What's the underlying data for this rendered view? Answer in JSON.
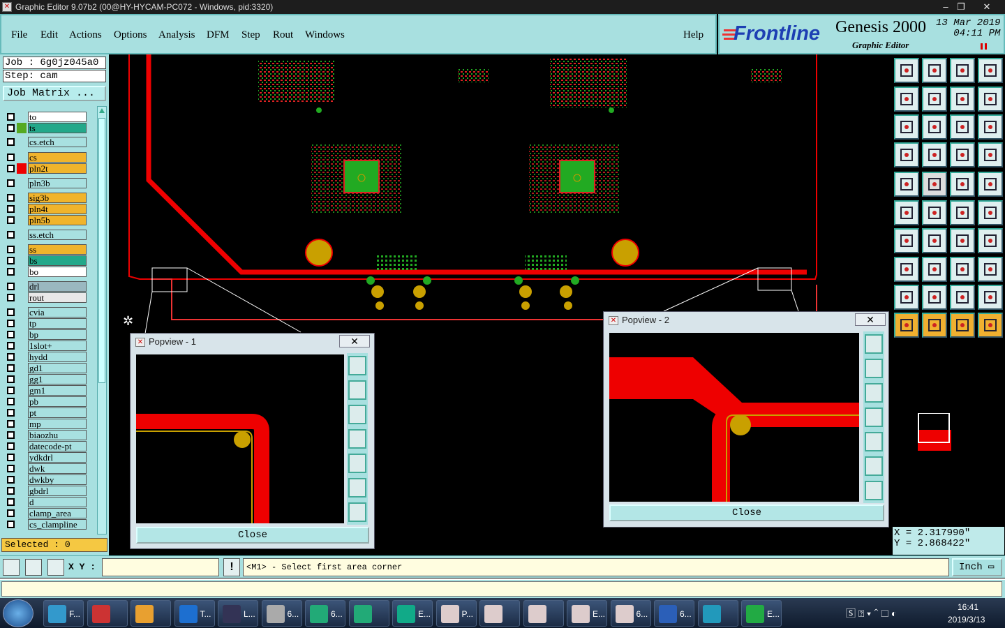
{
  "window": {
    "title": "Graphic Editor 9.07b2 (00@HY-HYCAM-PC072 - Windows, pid:3320)"
  },
  "menu": [
    "File",
    "Edit",
    "Actions",
    "Options",
    "Analysis",
    "DFM",
    "Step",
    "Rout",
    "Windows"
  ],
  "help": "Help",
  "brand": {
    "logo": "Frontline",
    "product": "Genesis 2000",
    "subtitle": "Graphic Editor",
    "date": "13 Mar 2019",
    "time": "04:11 PM"
  },
  "job": {
    "job_label": "Job : 6g0jz045a0",
    "step_label": "Step: cam",
    "matrix_button": "Job Matrix ..."
  },
  "layers": [
    {
      "name": "to",
      "color": "#ffffff"
    },
    {
      "name": "ts",
      "color": "#23a88a"
    },
    {
      "name": "cs.etch",
      "color": "#a8e0e0"
    },
    {
      "name": "cs",
      "color": "#f0b42c"
    },
    {
      "name": "pln2t",
      "color": "#f0b42c"
    },
    {
      "name": "pln3b",
      "color": "#a8e0e0"
    },
    {
      "name": "sig3b",
      "color": "#f0b42c"
    },
    {
      "name": "pln4t",
      "color": "#f0b42c"
    },
    {
      "name": "pln5b",
      "color": "#f0b42c"
    },
    {
      "name": "ss.etch",
      "color": "#a8e0e0"
    },
    {
      "name": "ss",
      "color": "#f0b42c"
    },
    {
      "name": "bs",
      "color": "#23a88a"
    },
    {
      "name": "bo",
      "color": "#ffffff"
    },
    {
      "name": "drl",
      "color": "#9ab8c0"
    },
    {
      "name": "rout",
      "color": "#e8e8e8"
    },
    {
      "name": "cvia",
      "color": "#a8e0e0"
    },
    {
      "name": "tp",
      "color": "#a8e0e0"
    },
    {
      "name": "bp",
      "color": "#a8e0e0"
    },
    {
      "name": "1slot+",
      "color": "#a8e0e0"
    },
    {
      "name": "hydd",
      "color": "#a8e0e0"
    },
    {
      "name": "gd1",
      "color": "#a8e0e0"
    },
    {
      "name": "gg1",
      "color": "#a8e0e0"
    },
    {
      "name": "gm1",
      "color": "#a8e0e0"
    },
    {
      "name": "pb",
      "color": "#a8e0e0"
    },
    {
      "name": "pt",
      "color": "#a8e0e0"
    },
    {
      "name": "mp",
      "color": "#a8e0e0"
    },
    {
      "name": "biaozhu",
      "color": "#a8e0e0"
    },
    {
      "name": "datecode-pt",
      "color": "#a8e0e0"
    },
    {
      "name": "ydkdrl",
      "color": "#a8e0e0"
    },
    {
      "name": "dwk",
      "color": "#a8e0e0"
    },
    {
      "name": "dwkby",
      "color": "#a8e0e0"
    },
    {
      "name": "gbdrl",
      "color": "#a8e0e0"
    },
    {
      "name": "d",
      "color": "#a8e0e0"
    },
    {
      "name": "clamp_area",
      "color": "#a8e0e0"
    },
    {
      "name": "cs_clampline",
      "color": "#a8e0e0"
    }
  ],
  "selected": "Selected : 0",
  "coords": {
    "x": "X = 2.317990\"",
    "y": "Y = 2.868422\""
  },
  "bottom": {
    "xy_label": "X Y :",
    "xy_value": "",
    "prompt": "<M1> - Select first area corner",
    "units": "Inch"
  },
  "popview1": {
    "title": "Popview - 1",
    "close": "Close"
  },
  "popview2": {
    "title": "Popview - 2",
    "close": "Close"
  },
  "taskbar": {
    "tasks": [
      "F...",
      "",
      "",
      "T...",
      "L...",
      "6...",
      "6...",
      "",
      "E...",
      "P...",
      "",
      "",
      "E...",
      "6...",
      "6...",
      "",
      "E..."
    ],
    "time": "16:41",
    "date": "2019/3/13"
  }
}
